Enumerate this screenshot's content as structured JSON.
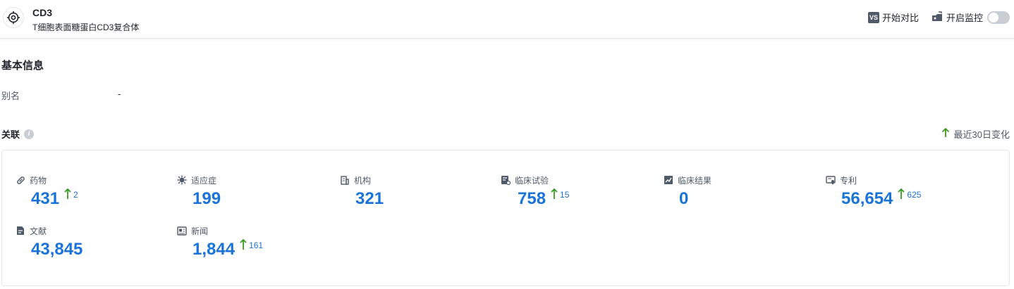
{
  "header": {
    "title": "CD3",
    "subtitle": "T细胞表面糖蛋白CD3复合体",
    "compare_label": "开始对比",
    "compare_icon_text": "VS",
    "monitor_label": "开启监控",
    "monitor_on": false
  },
  "basic_info": {
    "title": "基本信息",
    "alias_label": "别名",
    "alias_value": "-"
  },
  "relations": {
    "title": "关联",
    "recent_label": "最近30日变化",
    "up_color": "#3a9a1f",
    "number_color": "#1a73d9",
    "items": [
      {
        "label": "药物",
        "icon": "pill-icon",
        "value": "431",
        "delta": "2"
      },
      {
        "label": "适应症",
        "icon": "virus-icon",
        "value": "199",
        "delta": ""
      },
      {
        "label": "机构",
        "icon": "building-icon",
        "value": "321",
        "delta": ""
      },
      {
        "label": "临床试验",
        "icon": "clipboard-icon",
        "value": "758",
        "delta": "15"
      },
      {
        "label": "临床结果",
        "icon": "chart-doc-icon",
        "value": "0",
        "delta": ""
      },
      {
        "label": "专利",
        "icon": "certificate-icon",
        "value": "56,654",
        "delta": "625"
      },
      {
        "label": "文献",
        "icon": "document-icon",
        "value": "43,845",
        "delta": ""
      },
      {
        "label": "新闻",
        "icon": "newspaper-icon",
        "value": "1,844",
        "delta": "161"
      }
    ]
  }
}
